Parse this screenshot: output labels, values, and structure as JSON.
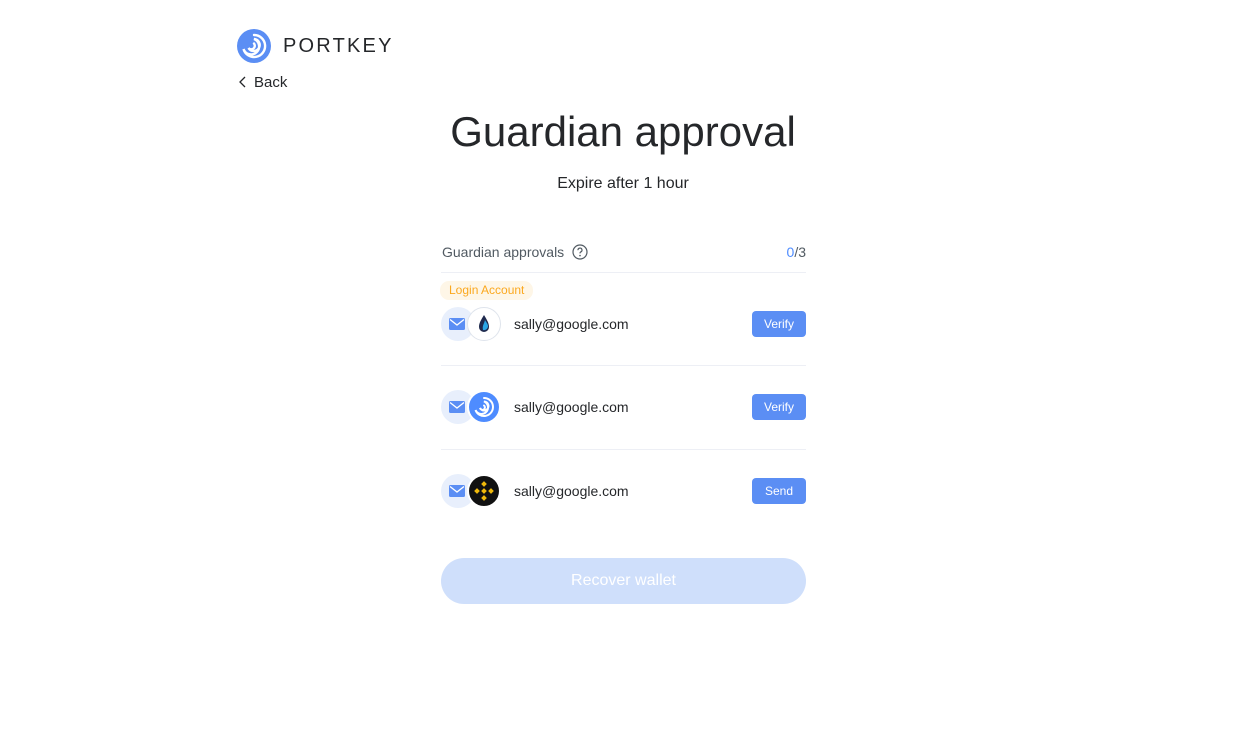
{
  "brand": {
    "name": "PORTKEY",
    "logo_icon": "portkey-swirl-icon",
    "color": "#4E8CFF"
  },
  "nav": {
    "back_label": "Back"
  },
  "page": {
    "title": "Guardian approval",
    "subtitle": "Expire after 1 hour"
  },
  "approvals": {
    "label": "Guardian approvals",
    "approved": "0",
    "separator": "/",
    "total": "3"
  },
  "guardians": [
    {
      "tag": "Login Account",
      "type_icon": "mail-icon",
      "verifier_icon": "blue-drop-verifier-icon",
      "email": "sally@google.com",
      "action_label": "Verify"
    },
    {
      "tag": "",
      "type_icon": "mail-icon",
      "verifier_icon": "portkey-verifier-icon",
      "email": "sally@google.com",
      "action_label": "Verify"
    },
    {
      "tag": "",
      "type_icon": "mail-icon",
      "verifier_icon": "binance-verifier-icon",
      "email": "sally@google.com",
      "action_label": "Send"
    }
  ],
  "footer": {
    "recover_label": "Recover wallet"
  },
  "colors": {
    "primary": "#5B8EF4",
    "primary_disabled": "#CFDFFB",
    "tag_text": "#FBA81F",
    "tag_bg": "#FEF6E7"
  }
}
